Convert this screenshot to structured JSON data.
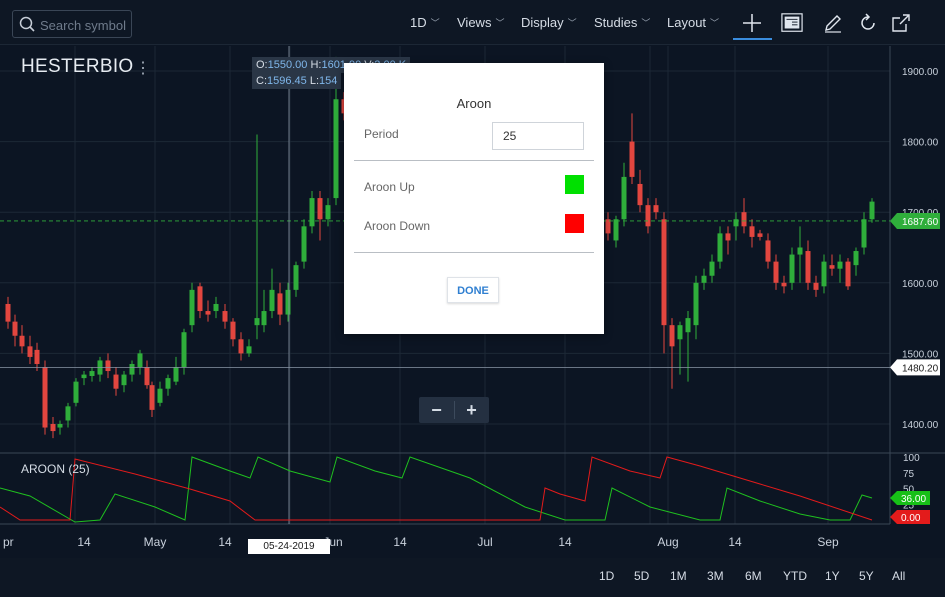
{
  "toolbar": {
    "search_placeholder": "Search symbol",
    "interval": "1D",
    "views": "Views",
    "display": "Display",
    "studies": "Studies",
    "layout": "Layout",
    "icons": [
      "search-icon",
      "crosshair-icon",
      "news-icon",
      "pencil-icon",
      "refresh-icon",
      "popout-icon"
    ]
  },
  "chart": {
    "symbol": "HESTERBIO",
    "menu_glyph": "⋮",
    "ohlc": {
      "o_label": "O:",
      "o": "1550.00",
      "h_label": "H:",
      "h": "1601.90",
      "v_label": "V:",
      "v": "2.00 K",
      "c_label": "C:",
      "c": "1596.45",
      "l_label": "L:",
      "l": "154"
    },
    "price_axis": [
      "1900.00",
      "1800.00",
      "1700.00",
      "1600.00",
      "1500.00",
      "1400.00"
    ],
    "last_price_tag": "1687.60",
    "crosshair_price_tag": "1480.20",
    "time_axis": [
      "pr",
      "14",
      "May",
      "14",
      "Jun",
      "14",
      "Jul",
      "14",
      "Aug",
      "14",
      "Sep"
    ],
    "crosshair_date": "05-24-2019",
    "zoom_out": "−",
    "zoom_in": "+",
    "colors": {
      "up": "#2fae3b",
      "down": "#e2463f",
      "background": "#0c1523",
      "grid": "#1c2836"
    }
  },
  "aroon_pane": {
    "label": "AROON (25)",
    "axis": [
      "100",
      "75",
      "50",
      "25"
    ],
    "up_tag": "36.00",
    "down_tag": "0.00",
    "colors": {
      "up": "#1fc01f",
      "down": "#e31b1b"
    }
  },
  "dialog": {
    "title": "Aroon",
    "period_label": "Period",
    "period_value": "25",
    "aroon_up_label": "Aroon Up",
    "aroon_down_label": "Aroon Down",
    "aroon_up_color": "#00e000",
    "aroon_down_color": "#ff0000",
    "done_label": "DONE"
  },
  "range_bar": [
    "1D",
    "5D",
    "1M",
    "3M",
    "6M",
    "YTD",
    "1Y",
    "5Y",
    "All"
  ]
}
